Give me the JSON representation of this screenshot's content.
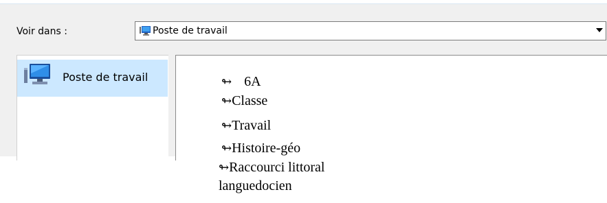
{
  "dialog": {
    "look_in_label": "Voir dans :",
    "look_in_value": "Poste de travail",
    "look_in_icon": "computer-icon"
  },
  "places": [
    {
      "label": "Poste de travail",
      "icon": "computer-icon",
      "selected": true
    }
  ],
  "files": [
    {
      "arrow": "↬",
      "label": "6A",
      "icon": "shortcut-arrow-icon"
    },
    {
      "arrow": "↬",
      "label": "Classe",
      "icon": "shortcut-arrow-icon"
    },
    {
      "arrow": "↬",
      "label": "Travail",
      "icon": "shortcut-arrow-icon"
    },
    {
      "arrow": "↬",
      "label": "Histoire-géo",
      "icon": "shortcut-arrow-icon"
    }
  ],
  "outside_item": {
    "arrow": "↬",
    "label": "Raccourci littoral languedocien",
    "icon": "shortcut-arrow-icon"
  },
  "colors": {
    "dialog_bg": "#f0f0f0",
    "selection_bg": "#cce8ff"
  }
}
